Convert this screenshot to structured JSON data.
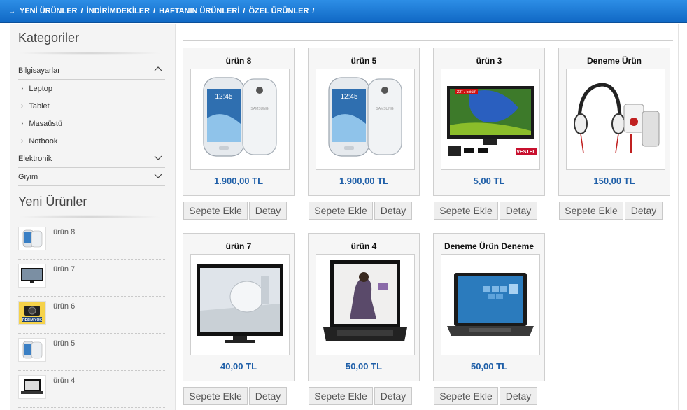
{
  "topnav": {
    "arrow": "→",
    "links": [
      "YENİ ÜRÜNLER",
      "İNDİRİMDEKİLER",
      "HAFTANIN ÜRÜNLERİ",
      "ÖZEL ÜRÜNLER"
    ],
    "separator": "/"
  },
  "sidebar": {
    "categories_title": "Kategoriler",
    "categories": [
      {
        "label": "Bilgisayarlar",
        "expanded": true,
        "children": [
          "Leptop",
          "Tablet",
          "Masaüstü",
          "Notbook"
        ]
      },
      {
        "label": "Elektronik",
        "expanded": false
      },
      {
        "label": "Giyim",
        "expanded": false
      }
    ],
    "new_products_title": "Yeni Ürünler",
    "new_products": [
      {
        "name": "ürün 8",
        "icon": "phone-thumbnail"
      },
      {
        "name": "ürün 7",
        "icon": "tv-thumbnail"
      },
      {
        "name": "ürün 6",
        "icon": "no-image-thumbnail",
        "badge": "RESİM YOK"
      },
      {
        "name": "ürün 5",
        "icon": "phone-thumbnail"
      },
      {
        "name": "ürün 4",
        "icon": "laptop-thumbnail"
      }
    ]
  },
  "products": [
    {
      "title": "ürün 8",
      "price": "1.900,00 TL",
      "image": "phone"
    },
    {
      "title": "ürün 5",
      "price": "1.900,00 TL",
      "image": "phone"
    },
    {
      "title": "ürün 3",
      "price": "5,00 TL",
      "image": "tv"
    },
    {
      "title": "Deneme Ürün",
      "price": "150,00 TL",
      "image": "headphones"
    },
    {
      "title": "ürün 7",
      "price": "40,00 TL",
      "image": "tv-room"
    },
    {
      "title": "ürün 4",
      "price": "50,00 TL",
      "image": "laptop"
    },
    {
      "title": "Deneme Ürün Deneme",
      "price": "50,00 TL",
      "image": "laptop-blue"
    }
  ],
  "buttons": {
    "add_to_cart": "Sepete Ekle",
    "detail": "Detay"
  },
  "tv_badges": [
    "22\" / 56cm",
    "VESTEL"
  ],
  "colors": {
    "nav_blue": "#1a78d6",
    "price_blue": "#1f5fa8"
  }
}
